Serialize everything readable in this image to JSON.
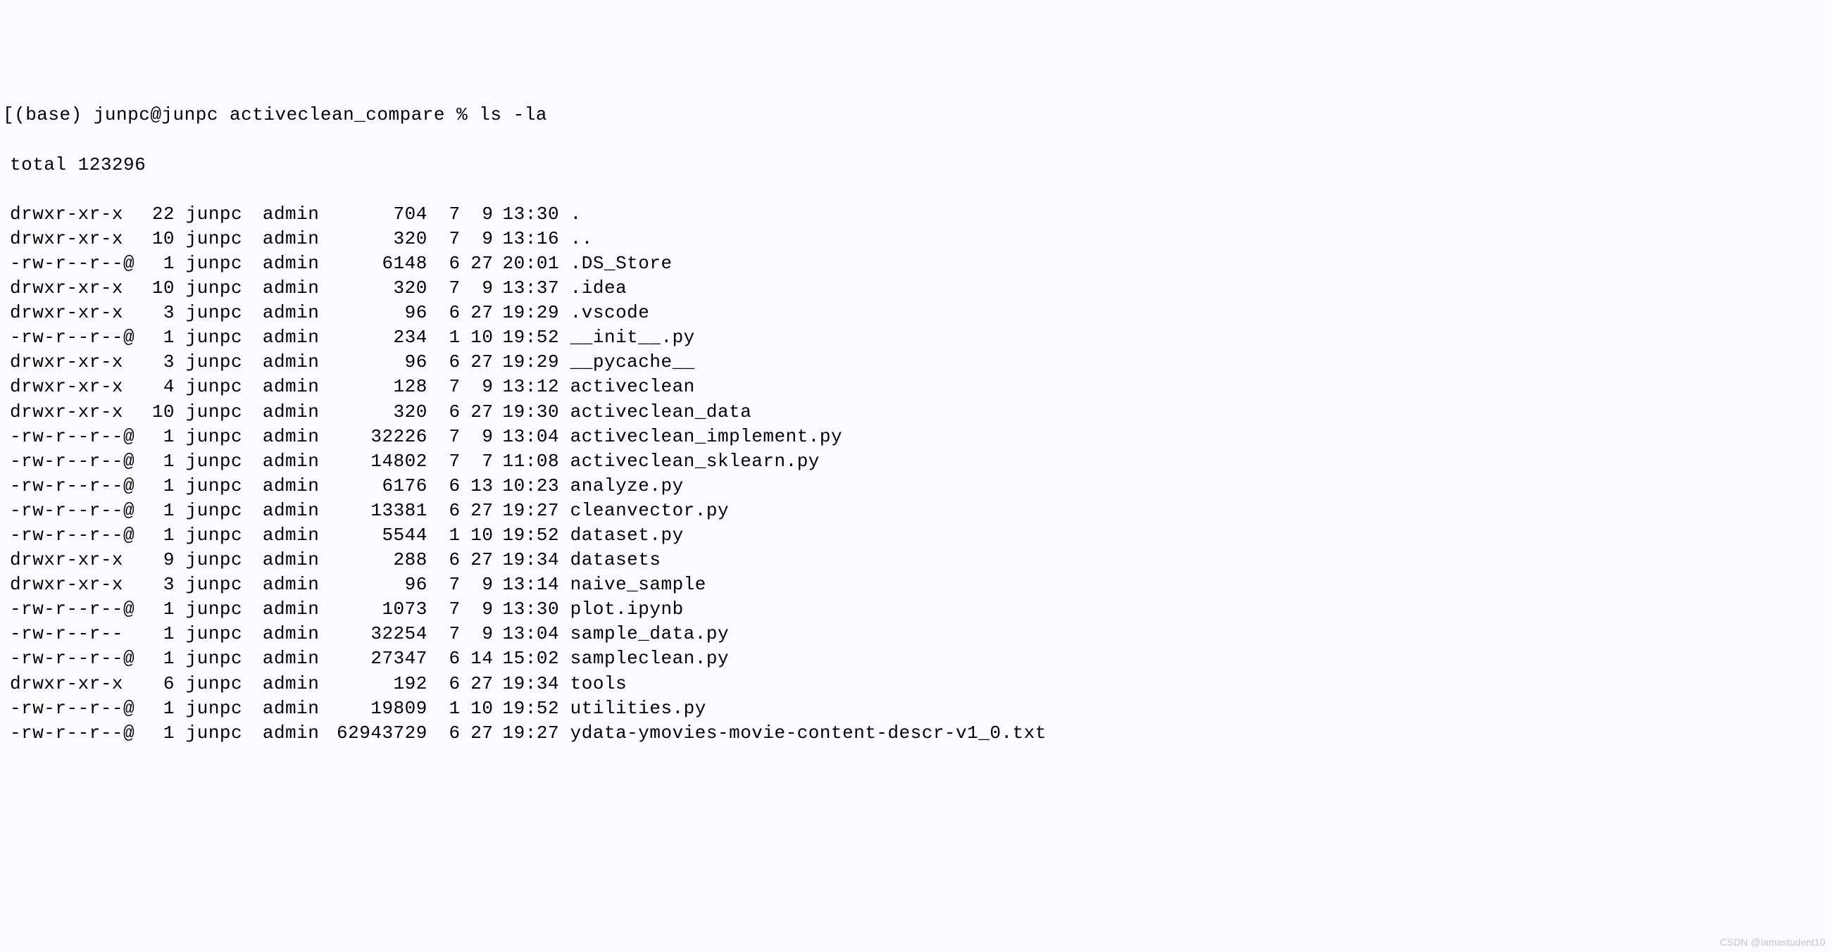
{
  "prompt": "[(base) junpc@junpc activeclean_compare % ls -la",
  "total_line": "total 123296",
  "watermark": "CSDN @iamastudent10",
  "entries": [
    {
      "perms": "drwxr-xr-x ",
      "links": "22",
      "user": "junpc",
      "group": "admin",
      "size": "704",
      "month": "7",
      "day": "9",
      "time": "13:30",
      "name": "."
    },
    {
      "perms": "drwxr-xr-x ",
      "links": "10",
      "user": "junpc",
      "group": "admin",
      "size": "320",
      "month": "7",
      "day": "9",
      "time": "13:16",
      "name": ".."
    },
    {
      "perms": "-rw-r--r--@",
      "links": "1",
      "user": "junpc",
      "group": "admin",
      "size": "6148",
      "month": "6",
      "day": "27",
      "time": "20:01",
      "name": ".DS_Store"
    },
    {
      "perms": "drwxr-xr-x ",
      "links": "10",
      "user": "junpc",
      "group": "admin",
      "size": "320",
      "month": "7",
      "day": "9",
      "time": "13:37",
      "name": ".idea"
    },
    {
      "perms": "drwxr-xr-x ",
      "links": "3",
      "user": "junpc",
      "group": "admin",
      "size": "96",
      "month": "6",
      "day": "27",
      "time": "19:29",
      "name": ".vscode"
    },
    {
      "perms": "-rw-r--r--@",
      "links": "1",
      "user": "junpc",
      "group": "admin",
      "size": "234",
      "month": "1",
      "day": "10",
      "time": "19:52",
      "name": "__init__.py"
    },
    {
      "perms": "drwxr-xr-x ",
      "links": "3",
      "user": "junpc",
      "group": "admin",
      "size": "96",
      "month": "6",
      "day": "27",
      "time": "19:29",
      "name": "__pycache__"
    },
    {
      "perms": "drwxr-xr-x ",
      "links": "4",
      "user": "junpc",
      "group": "admin",
      "size": "128",
      "month": "7",
      "day": "9",
      "time": "13:12",
      "name": "activeclean"
    },
    {
      "perms": "drwxr-xr-x ",
      "links": "10",
      "user": "junpc",
      "group": "admin",
      "size": "320",
      "month": "6",
      "day": "27",
      "time": "19:30",
      "name": "activeclean_data"
    },
    {
      "perms": "-rw-r--r--@",
      "links": "1",
      "user": "junpc",
      "group": "admin",
      "size": "32226",
      "month": "7",
      "day": "9",
      "time": "13:04",
      "name": "activeclean_implement.py"
    },
    {
      "perms": "-rw-r--r--@",
      "links": "1",
      "user": "junpc",
      "group": "admin",
      "size": "14802",
      "month": "7",
      "day": "7",
      "time": "11:08",
      "name": "activeclean_sklearn.py"
    },
    {
      "perms": "-rw-r--r--@",
      "links": "1",
      "user": "junpc",
      "group": "admin",
      "size": "6176",
      "month": "6",
      "day": "13",
      "time": "10:23",
      "name": "analyze.py"
    },
    {
      "perms": "-rw-r--r--@",
      "links": "1",
      "user": "junpc",
      "group": "admin",
      "size": "13381",
      "month": "6",
      "day": "27",
      "time": "19:27",
      "name": "cleanvector.py"
    },
    {
      "perms": "-rw-r--r--@",
      "links": "1",
      "user": "junpc",
      "group": "admin",
      "size": "5544",
      "month": "1",
      "day": "10",
      "time": "19:52",
      "name": "dataset.py"
    },
    {
      "perms": "drwxr-xr-x ",
      "links": "9",
      "user": "junpc",
      "group": "admin",
      "size": "288",
      "month": "6",
      "day": "27",
      "time": "19:34",
      "name": "datasets"
    },
    {
      "perms": "drwxr-xr-x ",
      "links": "3",
      "user": "junpc",
      "group": "admin",
      "size": "96",
      "month": "7",
      "day": "9",
      "time": "13:14",
      "name": "naive_sample"
    },
    {
      "perms": "-rw-r--r--@",
      "links": "1",
      "user": "junpc",
      "group": "admin",
      "size": "1073",
      "month": "7",
      "day": "9",
      "time": "13:30",
      "name": "plot.ipynb"
    },
    {
      "perms": "-rw-r--r-- ",
      "links": "1",
      "user": "junpc",
      "group": "admin",
      "size": "32254",
      "month": "7",
      "day": "9",
      "time": "13:04",
      "name": "sample_data.py"
    },
    {
      "perms": "-rw-r--r--@",
      "links": "1",
      "user": "junpc",
      "group": "admin",
      "size": "27347",
      "month": "6",
      "day": "14",
      "time": "15:02",
      "name": "sampleclean.py"
    },
    {
      "perms": "drwxr-xr-x ",
      "links": "6",
      "user": "junpc",
      "group": "admin",
      "size": "192",
      "month": "6",
      "day": "27",
      "time": "19:34",
      "name": "tools"
    },
    {
      "perms": "-rw-r--r--@",
      "links": "1",
      "user": "junpc",
      "group": "admin",
      "size": "19809",
      "month": "1",
      "day": "10",
      "time": "19:52",
      "name": "utilities.py"
    },
    {
      "perms": "-rw-r--r--@",
      "links": "1",
      "user": "junpc",
      "group": "admin",
      "size": "62943729",
      "month": "6",
      "day": "27",
      "time": "19:27",
      "name": "ydata-ymovies-movie-content-descr-v1_0.txt"
    }
  ]
}
